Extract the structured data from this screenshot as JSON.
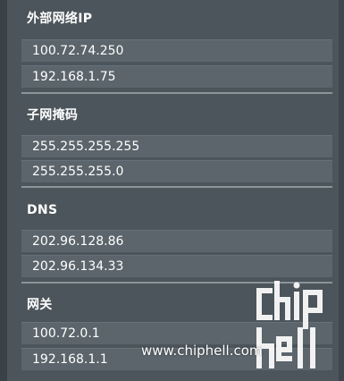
{
  "sections": [
    {
      "title": "外部网络IP",
      "values": [
        "100.72.74.250",
        "192.168.1.75"
      ]
    },
    {
      "title": "子网掩码",
      "values": [
        "255.255.255.255",
        "255.255.255.0"
      ]
    },
    {
      "title": "DNS",
      "values": [
        "202.96.128.86",
        "202.96.134.33"
      ]
    },
    {
      "title": "网关",
      "values": [
        "100.72.0.1",
        "192.168.1.1"
      ]
    }
  ],
  "watermark": {
    "logo_text": "chiphell",
    "url": "www.chiphell.com"
  }
}
